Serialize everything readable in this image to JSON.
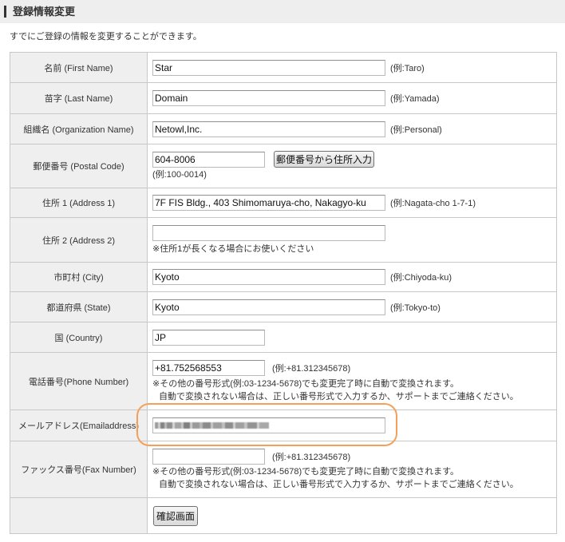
{
  "header": {
    "title": "登録情報変更"
  },
  "intro": "すでにご登録の情報を変更することができます。",
  "form": {
    "first_name": {
      "label": "名前 (First Name)",
      "value": "Star",
      "example": "(例:Taro)"
    },
    "last_name": {
      "label": "苗字 (Last Name)",
      "value": "Domain",
      "example": "(例:Yamada)"
    },
    "organization": {
      "label": "組織名 (Organization Name)",
      "value": "Netowl,Inc.",
      "example": "(例:Personal)"
    },
    "postal_code": {
      "label": "郵便番号 (Postal Code)",
      "value": "604-8006",
      "lookup_button": "郵便番号から住所入力",
      "example": "(例:100-0014)"
    },
    "address1": {
      "label": "住所 1 (Address 1)",
      "value": "7F FIS Bldg., 403 Shimomaruya-cho, Nakagyo-ku",
      "example": "(例:Nagata-cho 1-7-1)"
    },
    "address2": {
      "label": "住所 2 (Address 2)",
      "value": "",
      "note": "※住所1が長くなる場合にお使いください"
    },
    "city": {
      "label": "市町村 (City)",
      "value": "Kyoto",
      "example": "(例:Chiyoda-ku)"
    },
    "state": {
      "label": "都道府県 (State)",
      "value": "Kyoto",
      "example": "(例:Tokyo-to)"
    },
    "country": {
      "label": "国 (Country)",
      "value": "JP"
    },
    "phone": {
      "label": "電話番号(Phone Number)",
      "value": "+81.752568553",
      "example": "(例:+81.312345678)",
      "note_1": "※その他の番号形式(例:03-1234-5678)でも変更完了時に自動で変換されます。",
      "note_2": "自動で変換されない場合は、正しい番号形式で入力するか、サポートまでご連絡ください。"
    },
    "email": {
      "label": "メールアドレス(Emailaddress)"
    },
    "fax": {
      "label": "ファックス番号(Fax Number)",
      "value": "",
      "example": "(例:+81.312345678)",
      "note_1": "※その他の番号形式(例:03-1234-5678)でも変更完了時に自動で変換されます。",
      "note_2": "自動で変換されない場合は、正しい番号形式で入力するか、サポートまでご連絡ください。"
    },
    "confirm_button": "確認画面"
  },
  "colors": {
    "text": "#333333",
    "header_bg": "#eeeeee",
    "header_marker": "#333333",
    "label_bg": "#efefef",
    "border": "#c8c8c8",
    "highlight": "#f4a05a"
  }
}
